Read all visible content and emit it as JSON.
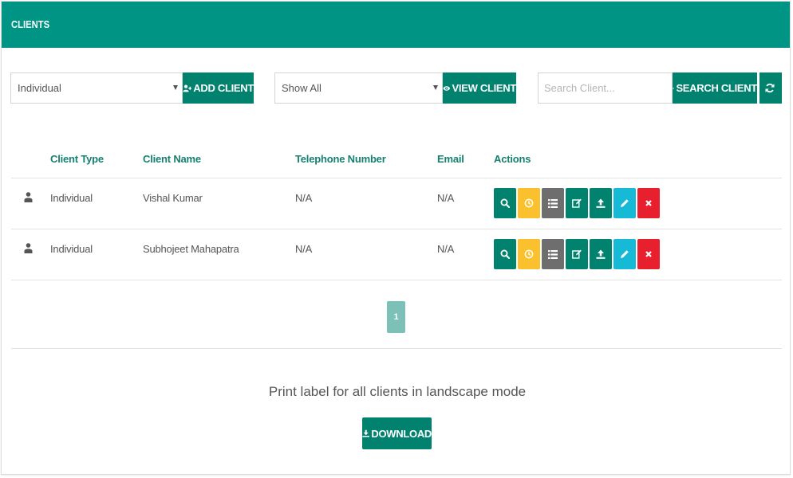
{
  "header": {
    "title": "CLIENTS"
  },
  "controls": {
    "client_type_select": "Individual",
    "add_client_label": "ADD CLIENT",
    "view_filter_select": "Show All",
    "view_client_label": "VIEW CLIENT",
    "search_placeholder": "Search Client...",
    "search_client_label": "SEARCH CLIENT"
  },
  "table": {
    "columns": [
      "Client Type",
      "Client Name",
      "Telephone Number",
      "Email",
      "Actions"
    ],
    "rows": [
      {
        "type": "Individual",
        "name": "Vishal Kumar",
        "phone": "N/A",
        "email": "N/A"
      },
      {
        "type": "Individual",
        "name": "Subhojeet Mahapatra",
        "phone": "N/A",
        "email": "N/A"
      }
    ]
  },
  "pagination": {
    "current_page": "1"
  },
  "footer": {
    "print_label": "Print label for all clients in landscape mode",
    "download_label": "DOWNLOAD"
  },
  "colors": {
    "header": "#009485",
    "primary": "#00826f",
    "warning": "#fbc02d",
    "gray": "#6e6e6e",
    "info": "#16b9d6",
    "danger": "#e81f2d"
  }
}
